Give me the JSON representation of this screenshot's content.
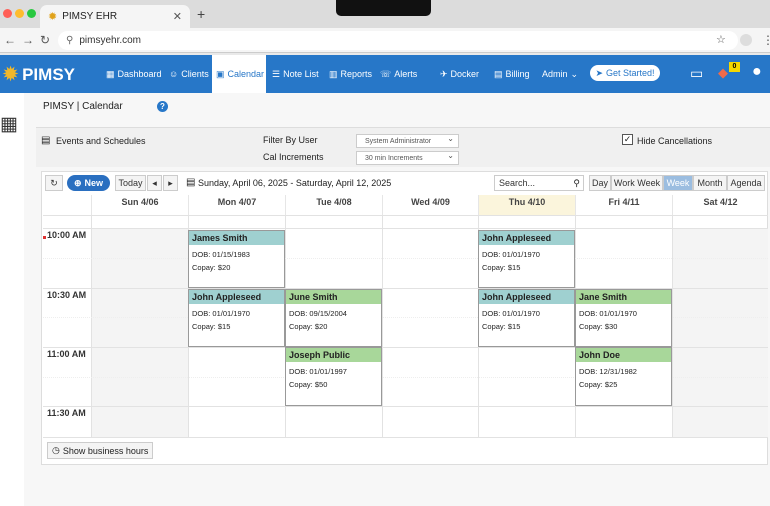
{
  "browser": {
    "tab_title": "PIMSY EHR",
    "url": "pimsyehr.com"
  },
  "header": {
    "logo_text": "PIMSY",
    "nav": [
      {
        "label": "Dashboard"
      },
      {
        "label": "Clients"
      },
      {
        "label": "Calendar"
      },
      {
        "label": "Note List"
      },
      {
        "label": "Reports"
      },
      {
        "label": "Alerts"
      },
      {
        "label": "Docker"
      },
      {
        "label": "Billing"
      },
      {
        "label": "Admin"
      }
    ],
    "get_started": "Get Started!",
    "notification_count": "0"
  },
  "page": {
    "title": "PIMSY | Calendar",
    "help_icon_text": "?"
  },
  "filters": {
    "events_label": "Events and Schedules",
    "filter_user_label": "Filter By User",
    "filter_user_value": "System Administrator",
    "cal_increments_label": "Cal Increments",
    "cal_increments_value": "30 min Increments",
    "hide_cancellations_label": "Hide Cancellations",
    "hide_cancellations_checked": true
  },
  "toolbar": {
    "new_label": "New",
    "today_label": "Today",
    "date_range": "Sunday, April 06, 2025 - Saturday, April 12, 2025",
    "search_placeholder": "Search...",
    "views": [
      "Day",
      "Work Week",
      "Week",
      "Month",
      "Agenda"
    ],
    "active_view": "Week"
  },
  "calendar": {
    "days": [
      "Sun 4/06",
      "Mon 4/07",
      "Tue 4/08",
      "Wed 4/09",
      "Thu 4/10",
      "Fri 4/11",
      "Sat 4/12"
    ],
    "today_index": 4,
    "times": [
      "10:00 AM",
      "10:30 AM",
      "11:00 AM",
      "11:30 AM"
    ],
    "appointments": [
      {
        "day": "Mon 4/07",
        "time": "10:00 AM",
        "name": "James Smith",
        "dob": "DOB: 01/15/1983",
        "copay": "Copay: $20",
        "color": "teal"
      },
      {
        "day": "Mon 4/07",
        "time": "10:30 AM",
        "name": "John Appleseed",
        "dob": "DOB: 01/01/1970",
        "copay": "Copay: $15",
        "color": "teal"
      },
      {
        "day": "Tue 4/08",
        "time": "10:30 AM",
        "name": "June Smith",
        "dob": "DOB: 09/15/2004",
        "copay": "Copay: $20",
        "color": "green"
      },
      {
        "day": "Tue 4/08",
        "time": "11:00 AM",
        "name": "Joseph Public",
        "dob": "DOB: 01/01/1997",
        "copay": "Copay: $50",
        "color": "green"
      },
      {
        "day": "Thu 4/10",
        "time": "10:00 AM",
        "name": "John Appleseed",
        "dob": "DOB: 01/01/1970",
        "copay": "Copay: $15",
        "color": "teal"
      },
      {
        "day": "Thu 4/10",
        "time": "10:30 AM",
        "name": "John Appleseed",
        "dob": "DOB: 01/01/1970",
        "copay": "Copay: $15",
        "color": "teal"
      },
      {
        "day": "Fri 4/11",
        "time": "10:30 AM",
        "name": "Jane Smith",
        "dob": "DOB: 01/01/1970",
        "copay": "Copay: $30",
        "color": "green"
      },
      {
        "day": "Fri 4/11",
        "time": "11:00 AM",
        "name": "John Doe",
        "dob": "DOB: 12/31/1982",
        "copay": "Copay: $25",
        "color": "green"
      }
    ],
    "show_business_hours": "Show business hours"
  },
  "colors": {
    "brand_blue": "#2777c8",
    "appt_teal": "#9fd0d0",
    "appt_green": "#a8d79a",
    "today_highlight": "#fbf5dc"
  }
}
